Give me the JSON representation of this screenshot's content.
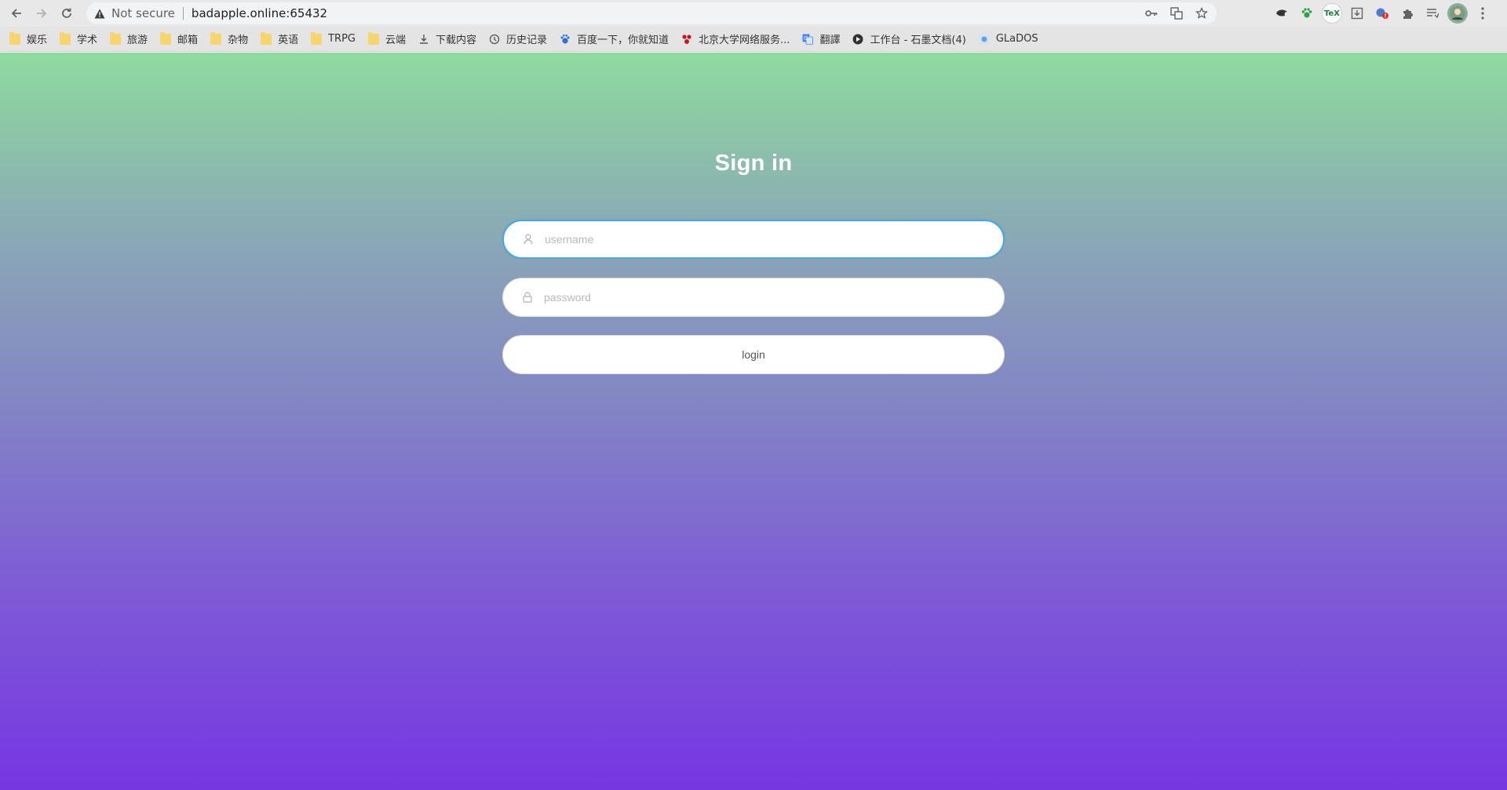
{
  "browser": {
    "security_label": "Not secure",
    "url": "badapple.online:65432"
  },
  "bookmarks": [
    {
      "label": "娱乐",
      "icon": "folder-icon"
    },
    {
      "label": "学术",
      "icon": "folder-icon"
    },
    {
      "label": "旅游",
      "icon": "folder-icon"
    },
    {
      "label": "邮箱",
      "icon": "folder-icon"
    },
    {
      "label": "杂物",
      "icon": "folder-icon"
    },
    {
      "label": "英语",
      "icon": "folder-icon"
    },
    {
      "label": "TRPG",
      "icon": "folder-icon"
    },
    {
      "label": "云端",
      "icon": "folder-icon"
    },
    {
      "label": "下载内容",
      "icon": "download-icon"
    },
    {
      "label": "历史记录",
      "icon": "history-icon"
    },
    {
      "label": "百度一下，你就知道",
      "icon": "baidu-icon"
    },
    {
      "label": "北京大学网络服务...",
      "icon": "pku-icon"
    },
    {
      "label": "翻譯",
      "icon": "translate-icon"
    },
    {
      "label": "工作台 - 石墨文档(4)",
      "icon": "shimo-icon"
    },
    {
      "label": "GLaDOS",
      "icon": "glados-icon"
    }
  ],
  "extensions": {
    "tex_label": "TeX"
  },
  "login": {
    "title": "Sign in",
    "username_placeholder": "username",
    "password_placeholder": "password",
    "button_label": "login"
  },
  "colors": {
    "gradient_top": "#8edb9f",
    "gradient_bottom": "#7636e2",
    "focus_border": "#49a6e2"
  }
}
